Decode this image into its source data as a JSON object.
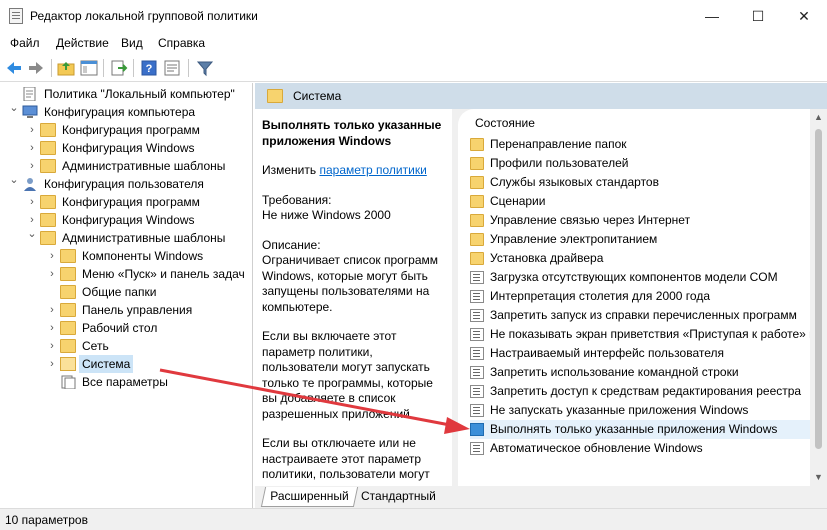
{
  "window": {
    "title": "Редактор локальной групповой политики",
    "minimize": "—",
    "maximize": "☐",
    "close": "✕"
  },
  "menu": [
    "Файл",
    "Действие",
    "Вид",
    "Справка"
  ],
  "toolbar": {
    "icons": [
      "back-icon",
      "forward-icon",
      "up-folder-icon",
      "show-hide-tree-icon",
      "export-list-icon",
      "help-icon",
      "properties-icon",
      "filter-icon"
    ]
  },
  "tree": [
    {
      "label": "Политика \"Локальный компьютер\"",
      "level": 0,
      "expander": "",
      "icon": "policy-doc-icon"
    },
    {
      "label": "Конфигурация компьютера",
      "level": 0,
      "expander": "v",
      "icon": "computer-icon"
    },
    {
      "label": "Конфигурация программ",
      "level": 1,
      "expander": ">",
      "icon": "folder-icon"
    },
    {
      "label": "Конфигурация Windows",
      "level": 1,
      "expander": ">",
      "icon": "folder-icon"
    },
    {
      "label": "Административные шаблоны",
      "level": 1,
      "expander": ">",
      "icon": "folder-icon"
    },
    {
      "label": "Конфигурация пользователя",
      "level": 0,
      "expander": "v",
      "icon": "user-icon"
    },
    {
      "label": "Конфигурация программ",
      "level": 1,
      "expander": ">",
      "icon": "folder-icon"
    },
    {
      "label": "Конфигурация Windows",
      "level": 1,
      "expander": ">",
      "icon": "folder-icon"
    },
    {
      "label": "Административные шаблоны",
      "level": 1,
      "expander": "v",
      "icon": "folder-icon"
    },
    {
      "label": "Компоненты Windows",
      "level": 2,
      "expander": ">",
      "icon": "folder-icon"
    },
    {
      "label": "Меню «Пуск» и панель задач",
      "level": 2,
      "expander": ">",
      "icon": "folder-icon"
    },
    {
      "label": "Общие папки",
      "level": 2,
      "expander": "",
      "icon": "folder-icon"
    },
    {
      "label": "Панель управления",
      "level": 2,
      "expander": ">",
      "icon": "folder-icon"
    },
    {
      "label": "Рабочий стол",
      "level": 2,
      "expander": ">",
      "icon": "folder-icon"
    },
    {
      "label": "Сеть",
      "level": 2,
      "expander": ">",
      "icon": "folder-icon"
    },
    {
      "label": "Система",
      "level": 2,
      "expander": ">",
      "icon": "folder-open-icon",
      "selected": true
    },
    {
      "label": "Все параметры",
      "level": 2,
      "expander": "",
      "icon": "all-settings-icon"
    }
  ],
  "right": {
    "header": "Система",
    "description": {
      "title": "Выполнять только указанные приложения Windows",
      "edit_prefix": "Изменить ",
      "edit_link": "параметр политики",
      "requirements_label": "Требования:",
      "requirements_value": "Не ниже Windows 2000",
      "description_label": "Описание:",
      "description_text": "Ограничивает список программ Windows, которые могут быть запущены пользователями на компьютере.",
      "enabled_text": "Если вы включаете этот параметр политики, пользователи могут запускать только те программы, которые вы добавляете в список разрешенных приложений.",
      "disabled_text": "Если вы отключаете или не настраиваете этот параметр политики, пользователи могут запускать все программы."
    },
    "list_header": "Состояние",
    "items": [
      {
        "label": "Перенаправление папок",
        "type": "folder"
      },
      {
        "label": "Профили пользователей",
        "type": "folder"
      },
      {
        "label": "Службы языковых стандартов",
        "type": "folder"
      },
      {
        "label": "Сценарии",
        "type": "folder"
      },
      {
        "label": "Управление связью через Интернет",
        "type": "folder"
      },
      {
        "label": "Управление электропитанием",
        "type": "folder"
      },
      {
        "label": "Установка драйвера",
        "type": "folder"
      },
      {
        "label": "Загрузка отсутствующих компонентов модели COM",
        "type": "setting"
      },
      {
        "label": "Интерпретация столетия для 2000 года",
        "type": "setting"
      },
      {
        "label": "Запретить запуск из справки перечисленных программ",
        "type": "setting"
      },
      {
        "label": "Не показывать экран приветствия «Приступая к работе» п",
        "type": "setting"
      },
      {
        "label": "Настраиваемый интерфейс пользователя",
        "type": "setting"
      },
      {
        "label": "Запретить использование командной строки",
        "type": "setting"
      },
      {
        "label": "Запретить доступ к средствам редактирования реестра",
        "type": "setting"
      },
      {
        "label": "Не запускать указанные приложения Windows",
        "type": "setting"
      },
      {
        "label": "Выполнять только указанные приложения Windows",
        "type": "setting",
        "highlighted": true
      },
      {
        "label": "Автоматическое обновление Windows",
        "type": "setting"
      }
    ],
    "tabs": [
      "Расширенный",
      "Стандартный"
    ]
  },
  "status": "10 параметров",
  "colors": {
    "accent_arrow": "#e0393e",
    "header_bg": "#cfdde9",
    "selection": "#cce4f7",
    "highlight": "#e5f1fb"
  }
}
